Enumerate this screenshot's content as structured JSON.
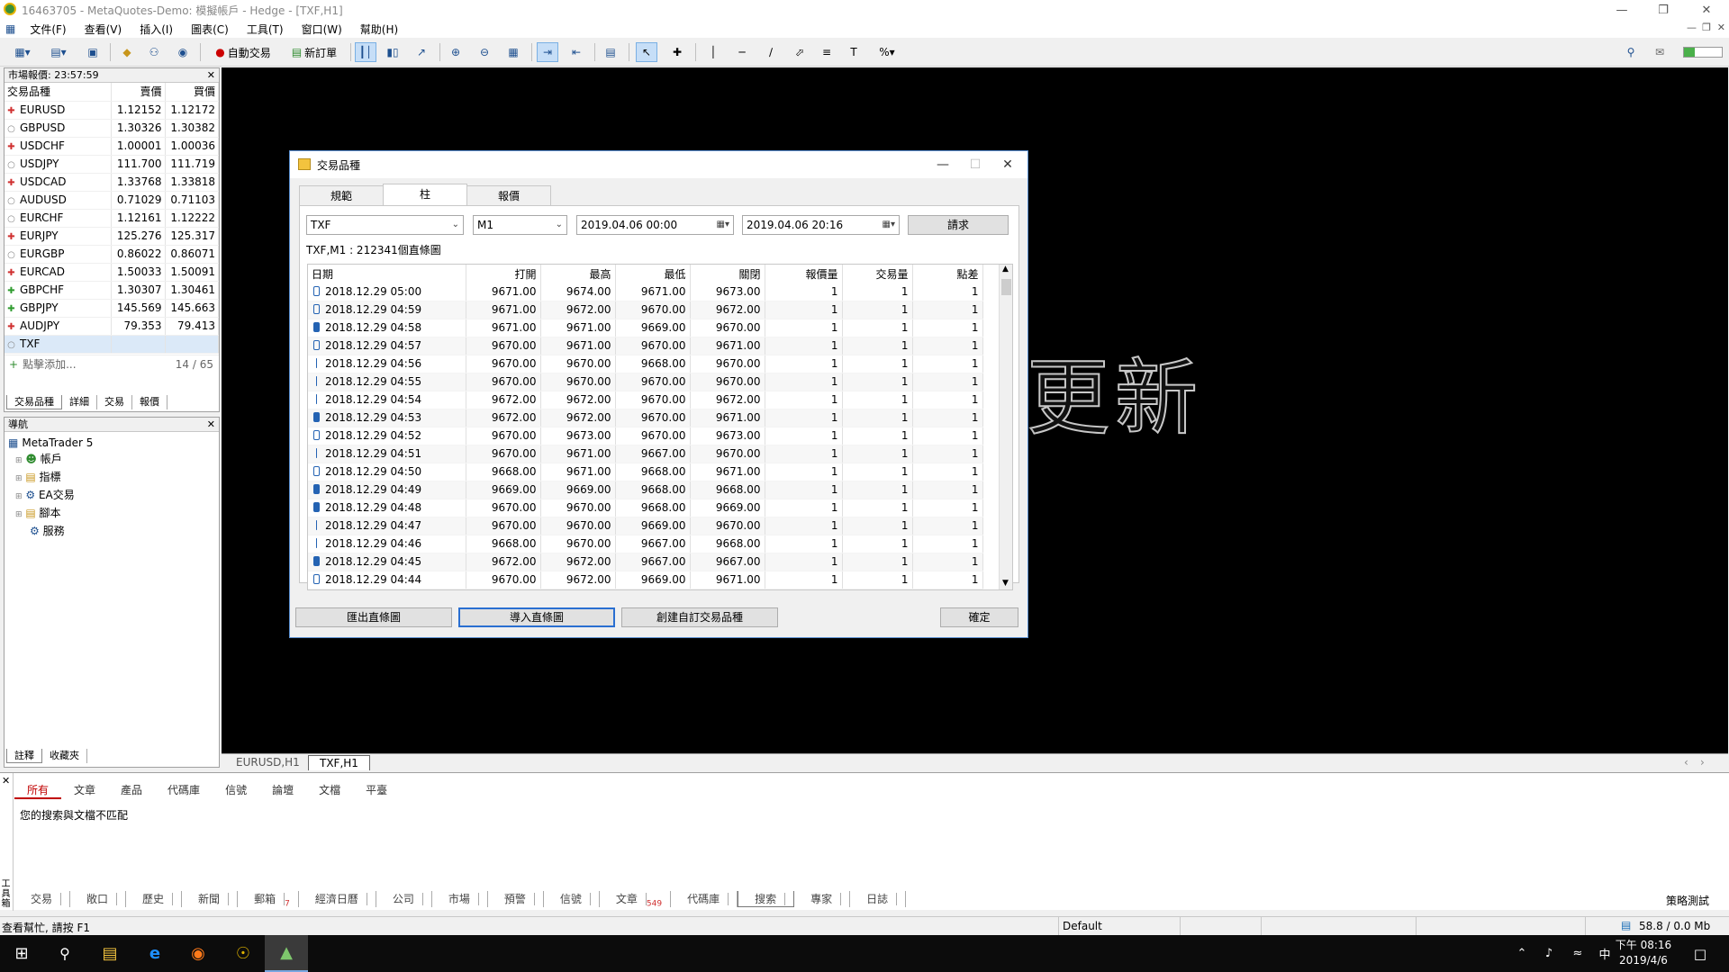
{
  "window": {
    "title": "16463705 - MetaQuotes-Demo: 模擬帳戶 - Hedge - [TXF,H1]"
  },
  "menu": [
    "文件(F)",
    "查看(V)",
    "插入(I)",
    "圖表(C)",
    "工具(T)",
    "窗口(W)",
    "幫助(H)"
  ],
  "toolbar": {
    "autotrade_label": "自動交易",
    "neworder_label": "新訂單"
  },
  "market_watch": {
    "title": "市場報價: 23:57:59",
    "headers": [
      "交易品種",
      "賣價",
      "買價"
    ],
    "rows": [
      {
        "symbol": "EURUSD",
        "bid": "1.12152",
        "ask": "1.12172",
        "dir": "up"
      },
      {
        "symbol": "GBPUSD",
        "bid": "1.30326",
        "ask": "1.30382",
        "dir": "none"
      },
      {
        "symbol": "USDCHF",
        "bid": "1.00001",
        "ask": "1.00036",
        "dir": "up"
      },
      {
        "symbol": "USDJPY",
        "bid": "111.700",
        "ask": "111.719",
        "dir": "none"
      },
      {
        "symbol": "USDCAD",
        "bid": "1.33768",
        "ask": "1.33818",
        "dir": "up"
      },
      {
        "symbol": "AUDUSD",
        "bid": "0.71029",
        "ask": "0.71103",
        "dir": "none"
      },
      {
        "symbol": "EURCHF",
        "bid": "1.12161",
        "ask": "1.12222",
        "dir": "none"
      },
      {
        "symbol": "EURJPY",
        "bid": "125.276",
        "ask": "125.317",
        "dir": "up"
      },
      {
        "symbol": "EURGBP",
        "bid": "0.86022",
        "ask": "0.86071",
        "dir": "none"
      },
      {
        "symbol": "EURCAD",
        "bid": "1.50033",
        "ask": "1.50091",
        "dir": "up"
      },
      {
        "symbol": "GBPCHF",
        "bid": "1.30307",
        "ask": "1.30461",
        "dir": "green"
      },
      {
        "symbol": "GBPJPY",
        "bid": "145.569",
        "ask": "145.663",
        "dir": "green"
      },
      {
        "symbol": "AUDJPY",
        "bid": "79.353",
        "ask": "79.413",
        "dir": "up"
      },
      {
        "symbol": "TXF",
        "bid": "",
        "ask": "",
        "dir": "none"
      }
    ],
    "add_label": "點擊添加...",
    "count": "14 / 65",
    "tabs": [
      "交易品種",
      "詳細",
      "交易",
      "報價"
    ]
  },
  "navigator": {
    "title": "導航",
    "root": "MetaTrader 5",
    "items": [
      "帳戶",
      "指標",
      "EA交易",
      "腳本",
      "服務"
    ],
    "tabs": [
      "註釋",
      "收藏夾"
    ]
  },
  "chart": {
    "overlay_text": "更新",
    "tabs": [
      "EURUSD,H1",
      "TXF,H1"
    ]
  },
  "dialog": {
    "title": "交易品種",
    "tabs": [
      "規範",
      "柱",
      "報價"
    ],
    "symbol": "TXF",
    "timeframe": "M1",
    "date_from": "2019.04.06 00:00",
    "date_to": "2019.04.06 20:16",
    "request_label": "請求",
    "info": "TXF,M1 : 212341個直條圖",
    "columns": [
      "日期",
      "打開",
      "最高",
      "最低",
      "關閉",
      "報價量",
      "交易量",
      "點差"
    ],
    "rows": [
      {
        "ico": "hollow",
        "d": "2018.12.29 05:00",
        "o": "9671.00",
        "h": "9674.00",
        "l": "9671.00",
        "c": "9673.00",
        "tv": "1",
        "v": "1",
        "s": "1"
      },
      {
        "ico": "hollow",
        "d": "2018.12.29 04:59",
        "o": "9671.00",
        "h": "9672.00",
        "l": "9670.00",
        "c": "9672.00",
        "tv": "1",
        "v": "1",
        "s": "1"
      },
      {
        "ico": "fill",
        "d": "2018.12.29 04:58",
        "o": "9671.00",
        "h": "9671.00",
        "l": "9669.00",
        "c": "9670.00",
        "tv": "1",
        "v": "1",
        "s": "1"
      },
      {
        "ico": "hollow",
        "d": "2018.12.29 04:57",
        "o": "9670.00",
        "h": "9671.00",
        "l": "9670.00",
        "c": "9671.00",
        "tv": "1",
        "v": "1",
        "s": "1"
      },
      {
        "ico": "line",
        "d": "2018.12.29 04:56",
        "o": "9670.00",
        "h": "9670.00",
        "l": "9668.00",
        "c": "9670.00",
        "tv": "1",
        "v": "1",
        "s": "1"
      },
      {
        "ico": "line",
        "d": "2018.12.29 04:55",
        "o": "9670.00",
        "h": "9670.00",
        "l": "9670.00",
        "c": "9670.00",
        "tv": "1",
        "v": "1",
        "s": "1"
      },
      {
        "ico": "line",
        "d": "2018.12.29 04:54",
        "o": "9672.00",
        "h": "9672.00",
        "l": "9670.00",
        "c": "9672.00",
        "tv": "1",
        "v": "1",
        "s": "1"
      },
      {
        "ico": "fill",
        "d": "2018.12.29 04:53",
        "o": "9672.00",
        "h": "9672.00",
        "l": "9670.00",
        "c": "9671.00",
        "tv": "1",
        "v": "1",
        "s": "1"
      },
      {
        "ico": "hollow",
        "d": "2018.12.29 04:52",
        "o": "9670.00",
        "h": "9673.00",
        "l": "9670.00",
        "c": "9673.00",
        "tv": "1",
        "v": "1",
        "s": "1"
      },
      {
        "ico": "line",
        "d": "2018.12.29 04:51",
        "o": "9670.00",
        "h": "9671.00",
        "l": "9667.00",
        "c": "9670.00",
        "tv": "1",
        "v": "1",
        "s": "1"
      },
      {
        "ico": "hollow",
        "d": "2018.12.29 04:50",
        "o": "9668.00",
        "h": "9671.00",
        "l": "9668.00",
        "c": "9671.00",
        "tv": "1",
        "v": "1",
        "s": "1"
      },
      {
        "ico": "fill",
        "d": "2018.12.29 04:49",
        "o": "9669.00",
        "h": "9669.00",
        "l": "9668.00",
        "c": "9668.00",
        "tv": "1",
        "v": "1",
        "s": "1"
      },
      {
        "ico": "fill",
        "d": "2018.12.29 04:48",
        "o": "9670.00",
        "h": "9670.00",
        "l": "9668.00",
        "c": "9669.00",
        "tv": "1",
        "v": "1",
        "s": "1"
      },
      {
        "ico": "line",
        "d": "2018.12.29 04:47",
        "o": "9670.00",
        "h": "9670.00",
        "l": "9669.00",
        "c": "9670.00",
        "tv": "1",
        "v": "1",
        "s": "1"
      },
      {
        "ico": "line",
        "d": "2018.12.29 04:46",
        "o": "9668.00",
        "h": "9670.00",
        "l": "9667.00",
        "c": "9668.00",
        "tv": "1",
        "v": "1",
        "s": "1"
      },
      {
        "ico": "fill",
        "d": "2018.12.29 04:45",
        "o": "9672.00",
        "h": "9672.00",
        "l": "9667.00",
        "c": "9667.00",
        "tv": "1",
        "v": "1",
        "s": "1"
      },
      {
        "ico": "hollow",
        "d": "2018.12.29 04:44",
        "o": "9670.00",
        "h": "9672.00",
        "l": "9669.00",
        "c": "9671.00",
        "tv": "1",
        "v": "1",
        "s": "1"
      }
    ],
    "buttons": {
      "export": "匯出直條圖",
      "import": "導入直條圖",
      "create": "創建自訂交易品種",
      "ok": "確定"
    }
  },
  "toolbox": {
    "tabs": [
      "所有",
      "文章",
      "產品",
      "代碼庫",
      "信號",
      "論壇",
      "文檔",
      "平臺"
    ],
    "message": "您的搜索與文檔不匹配",
    "side_label": "工具箱",
    "bottom_tabs": [
      {
        "label": "交易",
        "badge": ""
      },
      {
        "label": "敞口",
        "badge": ""
      },
      {
        "label": "歷史",
        "badge": ""
      },
      {
        "label": "新聞",
        "badge": ""
      },
      {
        "label": "郵箱",
        "badge": "7"
      },
      {
        "label": "經濟日曆",
        "badge": ""
      },
      {
        "label": "公司",
        "badge": ""
      },
      {
        "label": "市場",
        "badge": ""
      },
      {
        "label": "預警",
        "badge": ""
      },
      {
        "label": "信號",
        "badge": ""
      },
      {
        "label": "文章",
        "badge": "549"
      },
      {
        "label": "代碼庫",
        "badge": ""
      },
      {
        "label": "搜索",
        "badge": ""
      },
      {
        "label": "專家",
        "badge": ""
      },
      {
        "label": "日誌",
        "badge": ""
      }
    ],
    "strategy_tester": "策略測試"
  },
  "status": {
    "help": "查看幫忙, 請按 F1",
    "profile": "Default",
    "traffic": "58.8 / 0.0 Mb"
  },
  "taskbar": {
    "time": "下午 08:16",
    "date": "2019/4/6",
    "ime": "中"
  }
}
